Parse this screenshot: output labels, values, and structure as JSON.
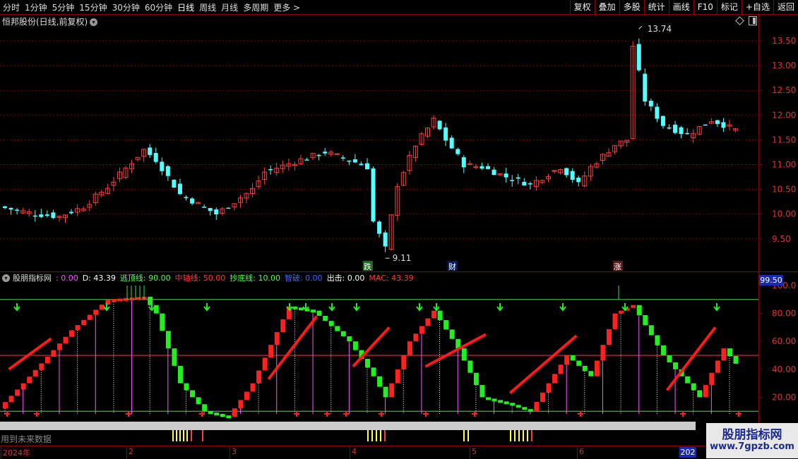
{
  "toolbar": {
    "periods": [
      "分时",
      "1分钟",
      "5分钟",
      "15分钟",
      "30分钟",
      "60分钟",
      "日线",
      "周线",
      "月线",
      "多周期",
      "更多 >"
    ],
    "active_period": "日线",
    "right_buttons": [
      "复权",
      "叠加",
      "多股",
      "统计",
      "画线",
      "F10",
      "标记",
      "+自选",
      "返回"
    ]
  },
  "stock": {
    "title": "恒邦股份(日线,前复权)",
    "high_label": "13.74",
    "low_label": "9.11",
    "price_axis": [
      "13.50",
      "13.00",
      "12.50",
      "12.00",
      "11.50",
      "11.00",
      "10.50",
      "10.00",
      "9.50"
    ],
    "event_tags": [
      "跌",
      "财",
      "涨"
    ],
    "colors": {
      "up": "#ff3c3c",
      "down": "#54ffff",
      "grid": "#8b0000"
    }
  },
  "indicator": {
    "name": "股朋指标网",
    "items": [
      {
        "label": ": 0.00",
        "color": "#ff55ff"
      },
      {
        "label": "D: 43.39",
        "color": "#ffffff"
      },
      {
        "label": "逃顶线: 90.00",
        "color": "#55ff55"
      },
      {
        "label": "中轴线: 50.00",
        "color": "#ff3c3c"
      },
      {
        "label": "抄底线: 10.00",
        "color": "#55ff55"
      },
      {
        "label": "智破: 0.00",
        "color": "#4466ff"
      },
      {
        "label": "出击: 0.00",
        "color": "#ffffff"
      },
      {
        "label": "MAC: 43.39",
        "color": "#ff3c3c"
      }
    ],
    "axis": [
      "100.0",
      "80.00",
      "60.00",
      "40.00",
      "20.00"
    ],
    "current_value": "99.50",
    "future_note": "用到未来数据"
  },
  "dates": {
    "labels": [
      "2024年",
      "2",
      "3",
      "4",
      "5",
      "6"
    ],
    "end_label": "202"
  },
  "watermark": {
    "title": "股朋指标网",
    "url": "www.7gpzb.com"
  }
}
